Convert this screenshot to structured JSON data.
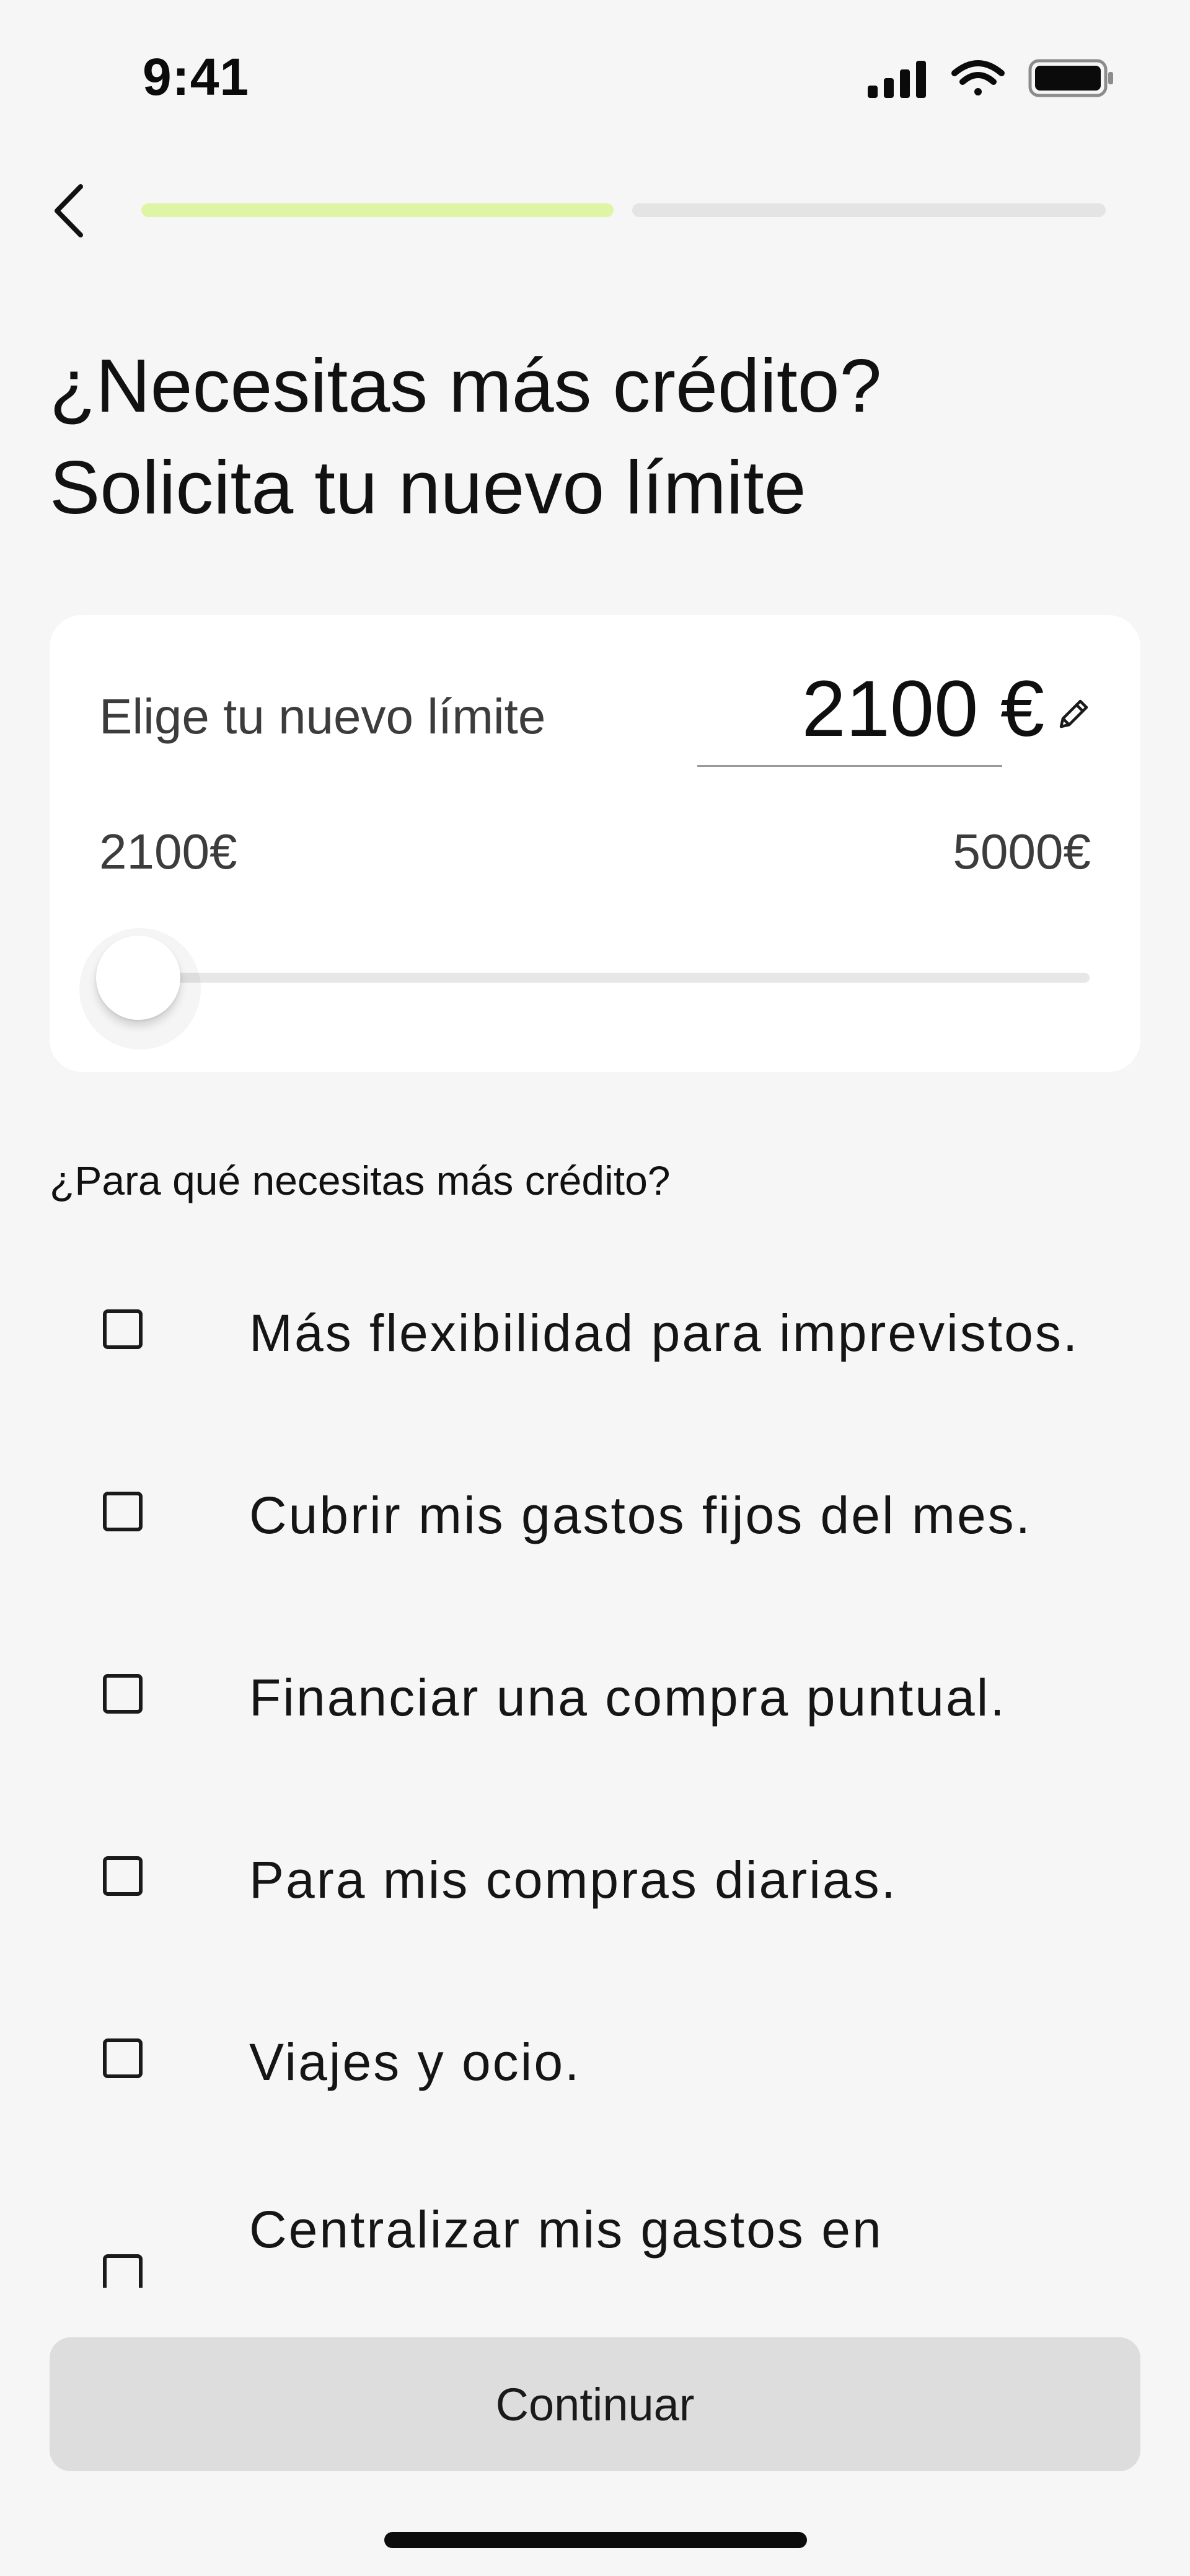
{
  "status_bar": {
    "time": "9:41",
    "icons": [
      "signal-icon",
      "wifi-icon",
      "battery-icon"
    ]
  },
  "header": {
    "back_icon": "chevron-left-icon",
    "progress": {
      "steps_total": 2,
      "steps_completed": 1
    },
    "colors": {
      "active": "#def5a6",
      "inactive": "#e4e4e4"
    }
  },
  "title": {
    "line1": "¿Necesitas más crédito?",
    "line2": "Solicita tu nuevo límite"
  },
  "limit_card": {
    "label": "Elige tu nuevo límite",
    "value": "2100 €",
    "edit_icon": "pencil-icon",
    "range_min": "2100€",
    "range_max": "5000€",
    "slider": {
      "min": 2100,
      "max": 5000,
      "value": 2100
    }
  },
  "question": "¿Para qué necesitas más crédito?",
  "options": [
    {
      "label": "Más flexibilidad para imprevistos.",
      "checked": false
    },
    {
      "label": "Cubrir mis gastos fijos del mes.",
      "checked": false
    },
    {
      "label": "Financiar una compra puntual.",
      "checked": false
    },
    {
      "label": "Para mis compras diarias.",
      "checked": false
    },
    {
      "label": "Viajes y ocio.",
      "checked": false
    },
    {
      "label": "Centralizar mis gastos en",
      "checked": false
    }
  ],
  "continue_button": {
    "label": "Continuar"
  }
}
